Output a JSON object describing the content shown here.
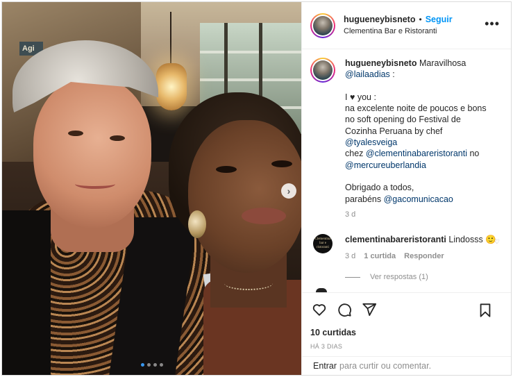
{
  "photo": {
    "sign_text": "Agi",
    "carousel": {
      "total": 4,
      "active": 0
    }
  },
  "header": {
    "username": "hugueneybisneto",
    "separator": "•",
    "follow_label": "Seguir",
    "location": "Clementina Bar e Ristoranti",
    "more_label": "•••"
  },
  "caption": {
    "username": "hugueneybisneto",
    "line1_text": "Maravilhosa",
    "mention1": "@lailaadias",
    "mention1_suffix": ":",
    "line2": "I ♥ you :",
    "line3": "na excelente noite de poucos e bons",
    "line4": "no soft opening do Festival de",
    "line5_text": "Cozinha Peruana by chef",
    "mention2": "@tyalesveiga",
    "line6_prefix": "chez",
    "mention3": "@clementinabareristoranti",
    "line6_suffix": "no",
    "mention4": "@mercureuberlandia",
    "line7": "Obrigado a todos,",
    "line8_prefix": "parabéns",
    "mention5": "@gacomunicacao",
    "time": "3 d"
  },
  "comment": {
    "avatar_text": "Clementina bar e ristoranti",
    "username": "clementinabareristoranti",
    "text": "Lindosss 🙂",
    "time": "3 d",
    "likes": "1 curtida",
    "reply_label": "Responder",
    "view_replies": "Ver respostas (1)",
    "heart": "♡"
  },
  "footer": {
    "likes": "10 curtidas",
    "date": "HÁ 3 DIAS",
    "login_link": "Entrar",
    "login_text": "para curtir ou comentar."
  },
  "icons": [
    "heart-icon",
    "comment-icon",
    "share-icon",
    "bookmark-icon",
    "chevron-right-icon"
  ],
  "colors": {
    "accent": "#0095f6",
    "mention": "#00376b",
    "muted": "#8e8e8e",
    "active_dot": "#3897f0"
  }
}
